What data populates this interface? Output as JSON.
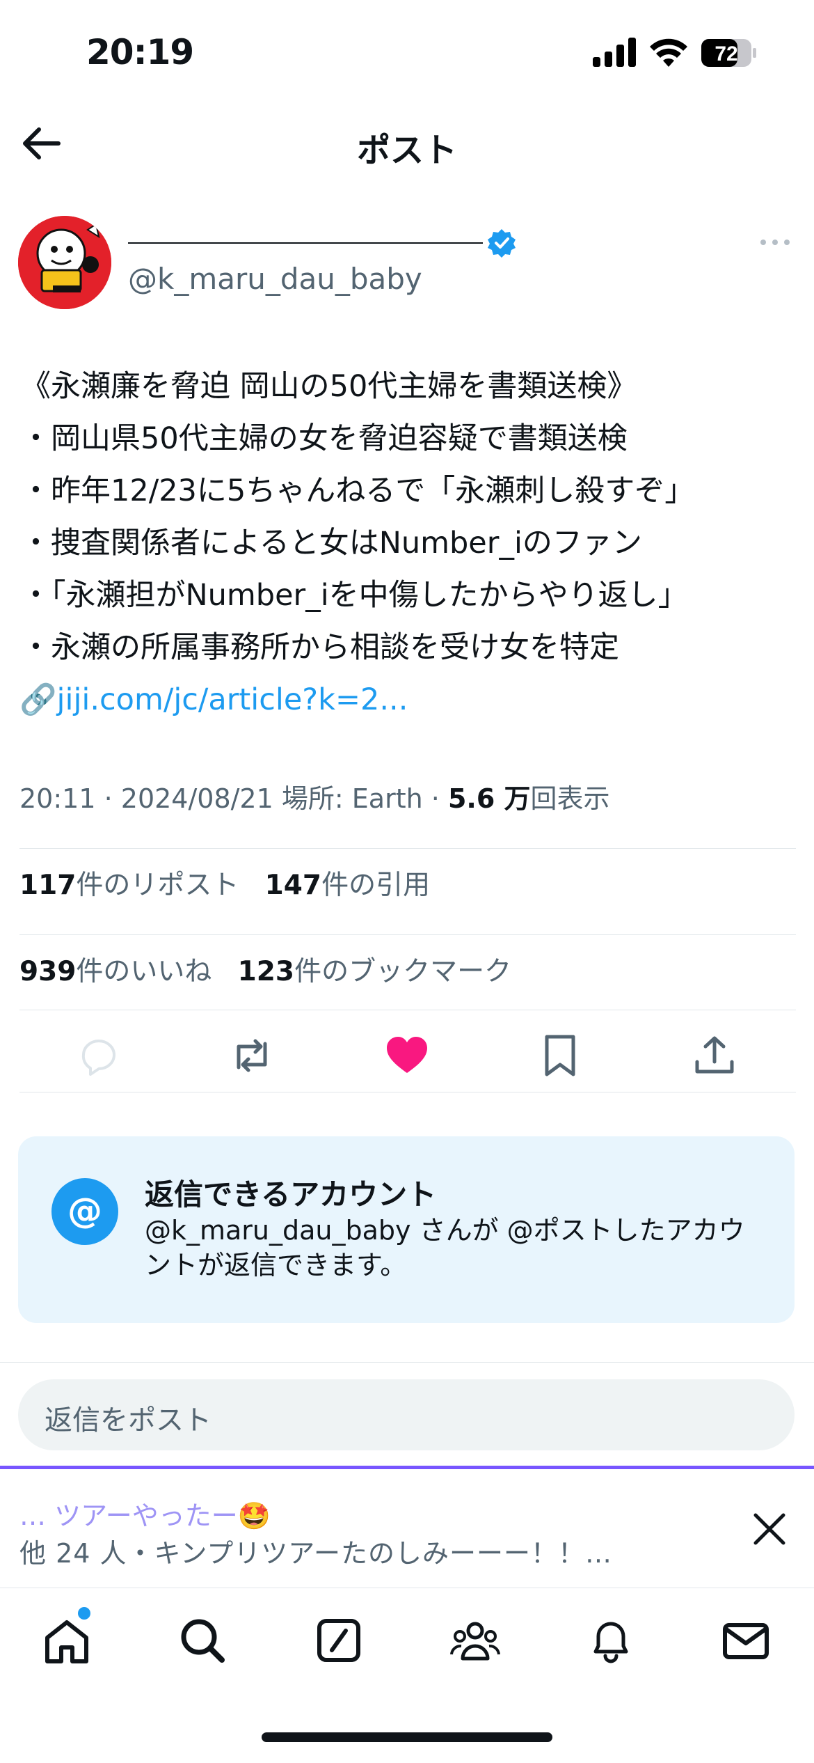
{
  "status_bar": {
    "time": "20:19",
    "battery": "72"
  },
  "header": {
    "title": "ポスト"
  },
  "author": {
    "handle": "@k_maru_dau_baby"
  },
  "post": {
    "lines": [
      "《永瀬廉を脅迫 岡山の50代主婦を書類送検》",
      "・岡山県50代主婦の女を脅迫容疑で書類送検",
      "・昨年12/23に5ちゃんねるで「永瀬刺し殺すぞ」",
      "・捜査関係者によると女はNumber_iのファン",
      "・「永瀬担がNumber_iを中傷したからやり返し」",
      "・永瀬の所属事務所から相談を受け女を特定"
    ],
    "link_emoji": "🔗",
    "link_text": "jiji.com/jc/article?k=2..."
  },
  "meta": {
    "time": "20:11",
    "date": "2024/08/21",
    "location": "場所: Earth",
    "views": "5.6 万",
    "views_label": "回表示"
  },
  "stats": {
    "reposts": "117",
    "reposts_label": "件のリポスト",
    "quotes": "147",
    "quotes_label": "件の引用",
    "likes": "939",
    "likes_label": "件のいいね",
    "bookmarks": "123",
    "bookmarks_label": "件のブックマーク"
  },
  "actions": {
    "icons": [
      "reply-icon",
      "repost-icon",
      "like-icon",
      "bookmark-icon",
      "share-icon"
    ],
    "like_color": "#f91880"
  },
  "reply_settings": {
    "icon": "@",
    "title": "返信できるアカウント",
    "description": "@k_maru_dau_baby さんが @ポストしたアカウントが返信できます。"
  },
  "reply_input": {
    "placeholder": "返信をポスト"
  },
  "notification": {
    "title": "… ツアーやったー🤩",
    "text": "他 24 人・キンプリツアーたのしみーーー！！…"
  },
  "tab_bar": {
    "items": [
      "home-icon",
      "search-icon",
      "grok-icon",
      "communities-icon",
      "notifications-icon",
      "messages-icon"
    ]
  },
  "colors": {
    "accent": "#1d9bf0",
    "purple": "#7856ff",
    "text": "#0f1419",
    "secondary": "#536471"
  }
}
